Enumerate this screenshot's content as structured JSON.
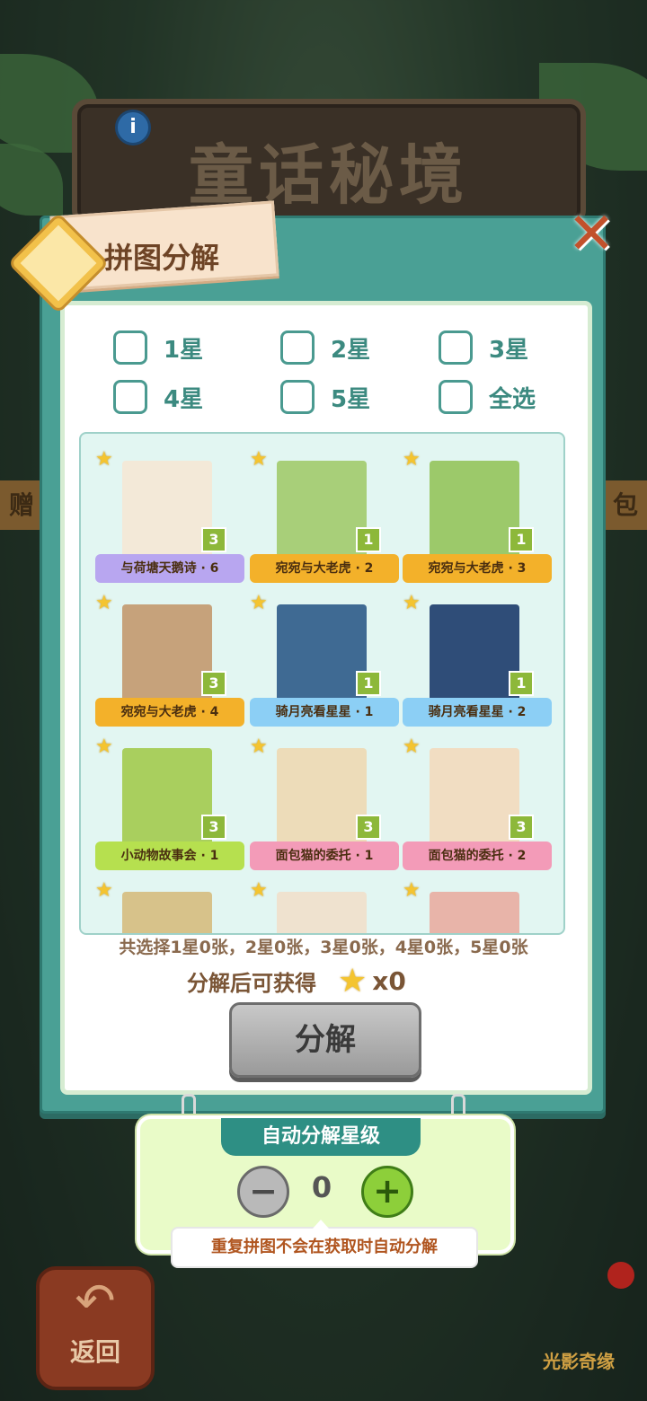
{
  "background": {
    "banner_title": "童话秘境",
    "left_tab": "赠",
    "right_tab": "包",
    "back_button": "返回",
    "logo_text": "光影奇缘",
    "info_icon": "info-icon"
  },
  "dialog": {
    "title": "拼图分解",
    "close_icon": "close-icon"
  },
  "filters": {
    "star1": "1星",
    "star2": "2星",
    "star3": "3星",
    "star4": "4星",
    "star5": "5星",
    "all": "全选"
  },
  "pieces": [
    {
      "label": "与荷塘天鹅诗 · 6",
      "count": "3",
      "ribbon_color": "#b8a6f0",
      "img_color": "#f3e9d8"
    },
    {
      "label": "宛宛与大老虎 · 2",
      "count": "1",
      "ribbon_color": "#f3b12a",
      "img_color": "#a8cf79"
    },
    {
      "label": "宛宛与大老虎 · 3",
      "count": "1",
      "ribbon_color": "#f3b12a",
      "img_color": "#9cc96a"
    },
    {
      "label": "宛宛与大老虎 · 4",
      "count": "3",
      "ribbon_color": "#f3b12a",
      "img_color": "#c6a27b"
    },
    {
      "label": "骑月亮看星星 · 1",
      "count": "1",
      "ribbon_color": "#8ccff5",
      "img_color": "#3f6a93"
    },
    {
      "label": "骑月亮看星星 · 2",
      "count": "1",
      "ribbon_color": "#8ccff5",
      "img_color": "#2f4d78"
    },
    {
      "label": "小动物故事会 · 1",
      "count": "3",
      "ribbon_color": "#b6e04f",
      "img_color": "#a9cf5e"
    },
    {
      "label": "面包猫的委托 · 1",
      "count": "3",
      "ribbon_color": "#f39bb8",
      "img_color": "#eddcb9"
    },
    {
      "label": "面包猫的委托 · 2",
      "count": "3",
      "ribbon_color": "#f39bb8",
      "img_color": "#f1ddc2"
    },
    {
      "label": "",
      "count": "",
      "ribbon_color": "#b6e04f",
      "img_color": "#d7c28a"
    },
    {
      "label": "",
      "count": "",
      "ribbon_color": "#f39bb8",
      "img_color": "#efe2cf"
    },
    {
      "label": "",
      "count": "",
      "ribbon_color": "#f39bb8",
      "img_color": "#e8b4a9"
    }
  ],
  "summary": "共选择1星0张，2星0张，3星0张，4星0张，5星0张",
  "reward": {
    "label": "分解后可获得",
    "count": "x0"
  },
  "decompose_button": "分解",
  "auto": {
    "title": "自动分解星级",
    "value": "0",
    "tooltip": "重复拼图不会在获取时自动分解"
  }
}
